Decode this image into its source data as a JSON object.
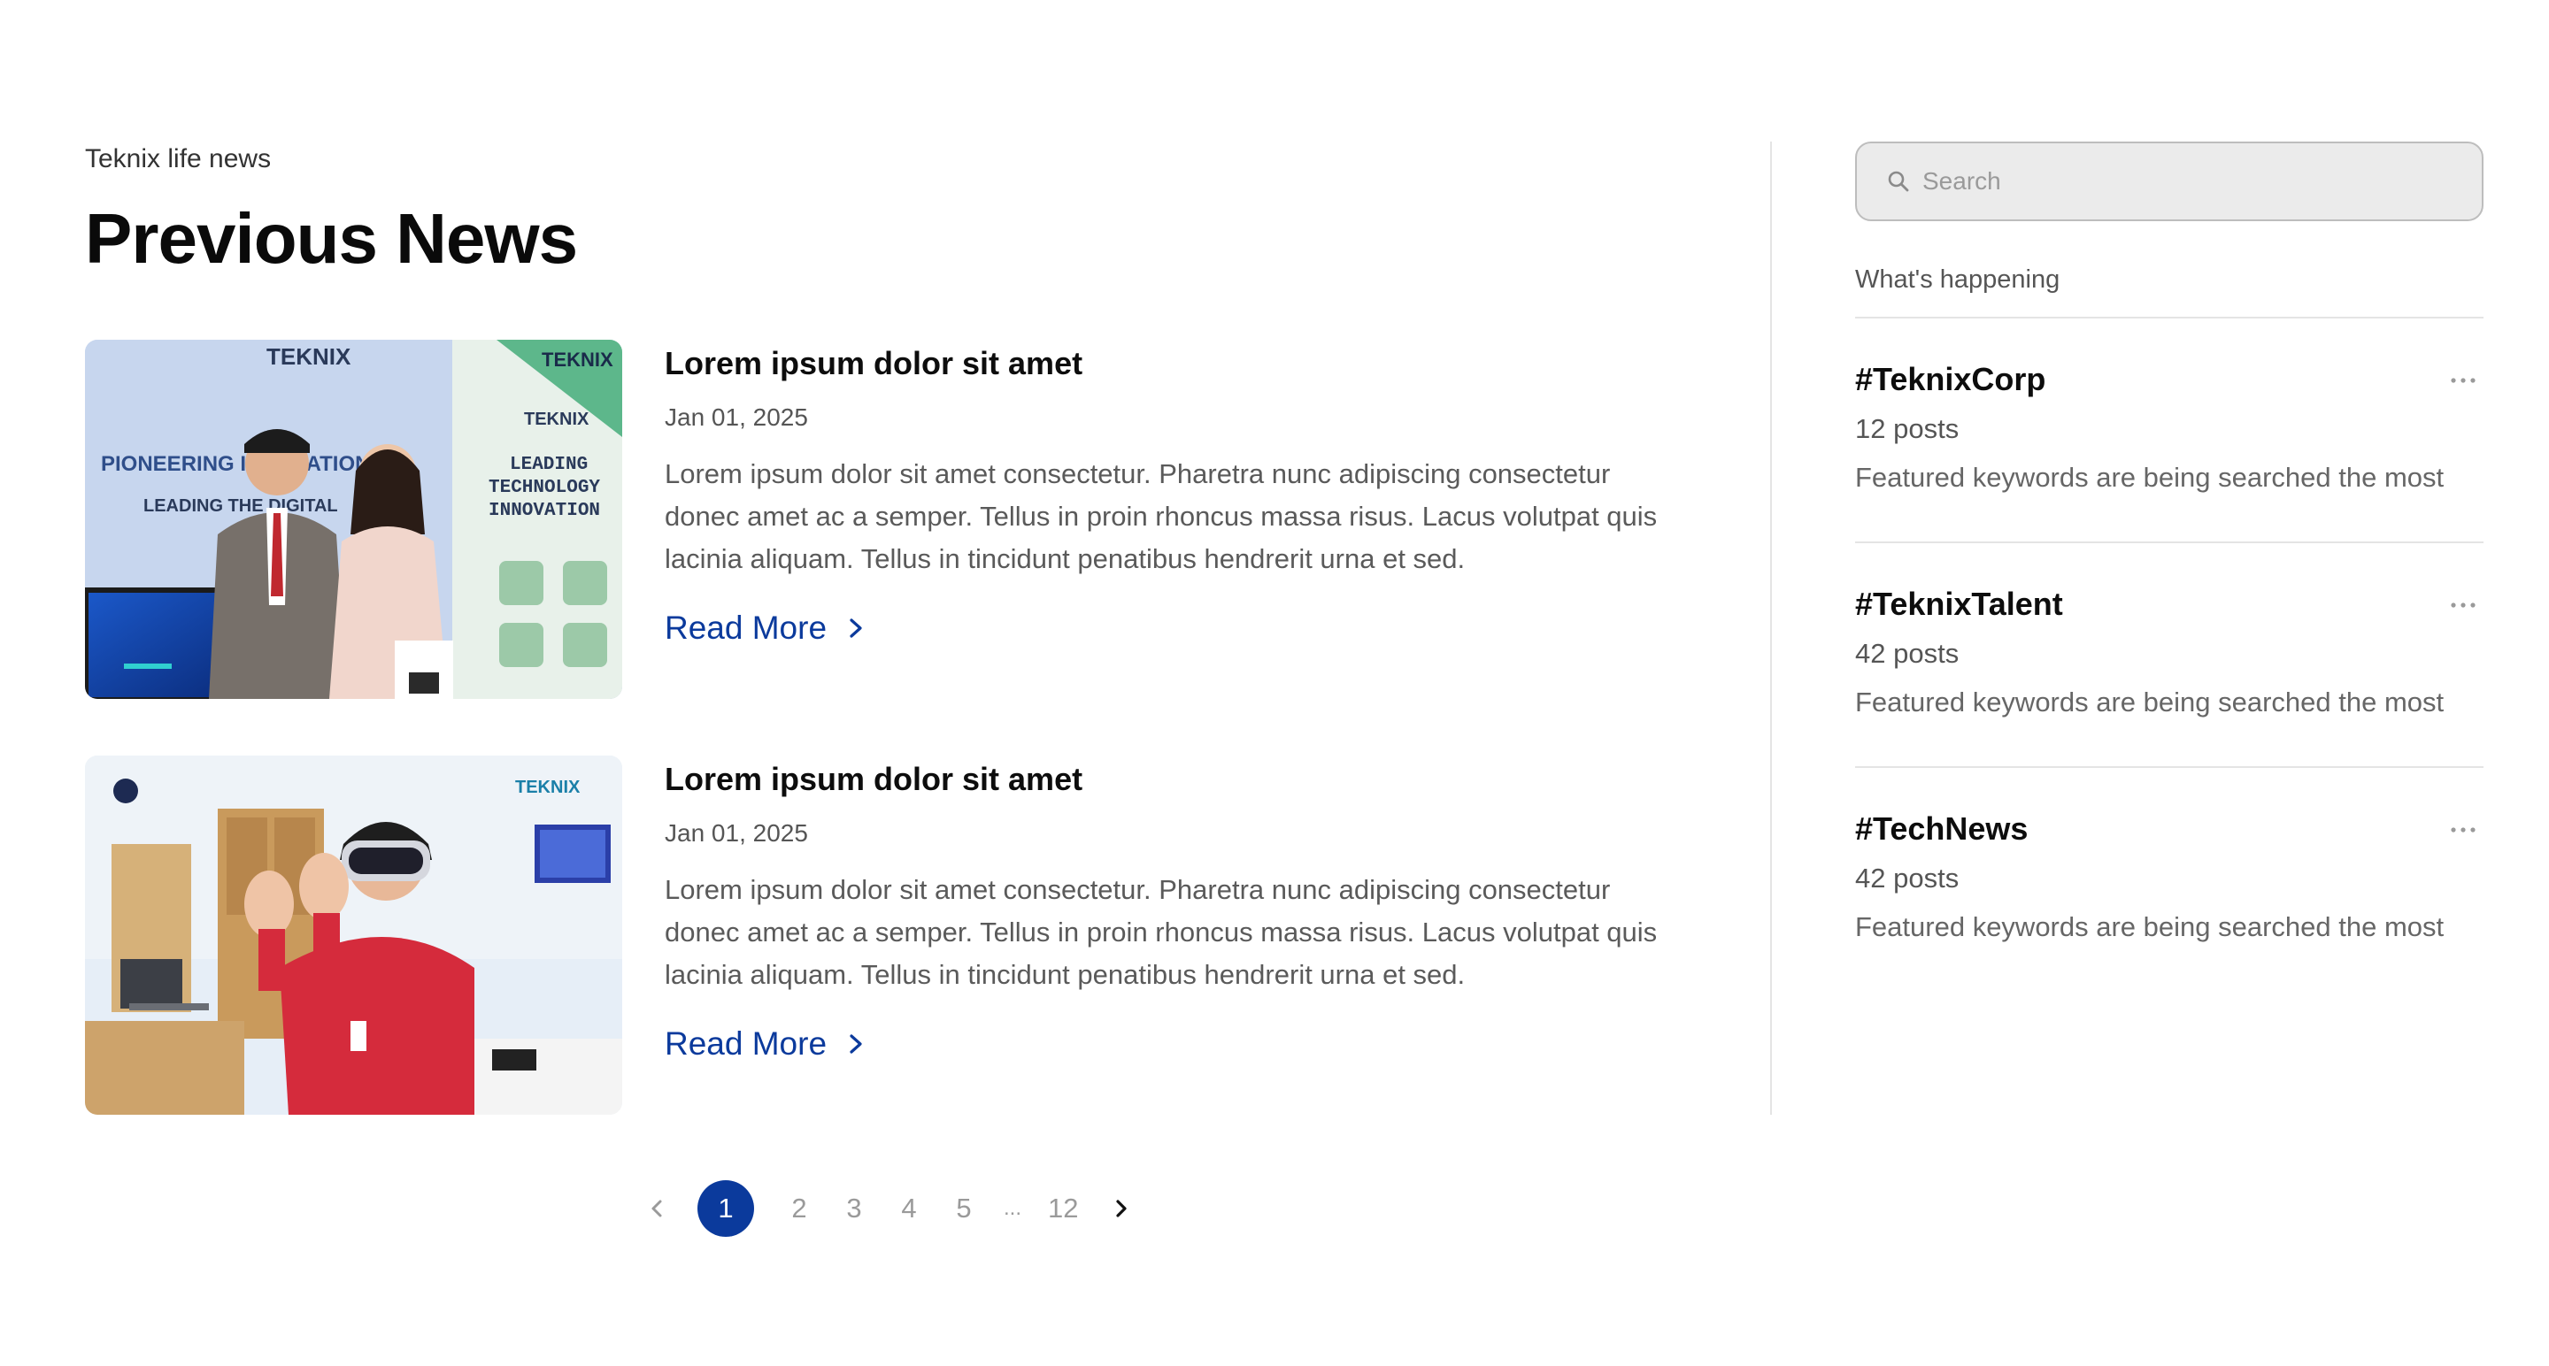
{
  "header": {
    "eyebrow": "Teknix life news",
    "title": "Previous News"
  },
  "news": [
    {
      "title": "Lorem ipsum dolor sit amet",
      "date": "Jan 01, 2025",
      "excerpt": "Lorem ipsum dolor sit amet consectetur. Pharetra nunc adipiscing consectetur donec amet ac a semper. Tellus in proin rhoncus massa risus. Lacus volutpat quis lacinia aliquam. Tellus in tincidunt penatibus hendrerit urna et sed.",
      "read_more": "Read More",
      "image": {
        "logo_text": "TEKNIX",
        "banner_left_1": "PIONEERING INNOVATIONS",
        "banner_left_2": "LEADING THE DIGITAL",
        "banner_right_1": "LEADING",
        "banner_right_2": "TECHNOLOGY",
        "banner_right_3": "INNOVATION"
      }
    },
    {
      "title": "Lorem ipsum dolor sit amet",
      "date": "Jan 01, 2025",
      "excerpt": "Lorem ipsum dolor sit amet consectetur. Pharetra nunc adipiscing consectetur donec amet ac a semper. Tellus in proin rhoncus massa risus. Lacus volutpat quis lacinia aliquam. Tellus in tincidunt penatibus hendrerit urna et sed.",
      "read_more": "Read More",
      "image": {
        "logo_text": "TEKNIX"
      }
    }
  ],
  "pagination": {
    "current": "1",
    "pages": [
      "2",
      "3",
      "4",
      "5"
    ],
    "ellipsis": "...",
    "last": "12"
  },
  "sidebar": {
    "search_placeholder": "Search",
    "section_label": "What's happening",
    "trends": [
      {
        "tag": "#TeknixCorp",
        "count": "12 posts",
        "desc": "Featured keywords are being searched the most"
      },
      {
        "tag": "#TeknixTalent",
        "count": "42 posts",
        "desc": "Featured keywords are being searched the most"
      },
      {
        "tag": "#TechNews",
        "count": "42 posts",
        "desc": "Featured keywords are being searched the most"
      }
    ]
  },
  "colors": {
    "accent": "#0b3a9c",
    "muted_text": "#5a5a5a",
    "divider": "#e4e4e4"
  },
  "icons": [
    "search-icon",
    "chevron-right-icon",
    "chevron-left-icon",
    "more-horizontal-icon"
  ]
}
